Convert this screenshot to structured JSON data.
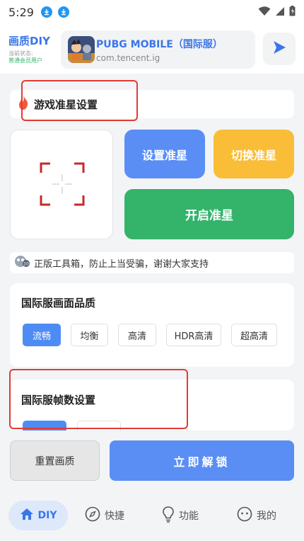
{
  "status_bar": {
    "time": "5:29"
  },
  "header": {
    "brand_title": "画质DIY",
    "brand_sub": "当前状态:",
    "brand_status": "普通会员用户",
    "game_name": "PUBG MOBILE（国际服）",
    "game_package": "com.tencent.ig"
  },
  "crosshair": {
    "section_title": "游戏准星设置",
    "set_label": "设置准星",
    "switch_label": "切换准星",
    "enable_label": "开启准星"
  },
  "notice": {
    "text": "正版工具箱，防止上当受骗，谢谢大家支持"
  },
  "quality": {
    "title": "国际服画面品质",
    "options": [
      "流畅",
      "均衡",
      "高清",
      "HDR高清",
      "超高清"
    ],
    "selected": "流畅"
  },
  "fps": {
    "title": "国际服帧数设置"
  },
  "actions": {
    "reset_label": "重置画质",
    "unlock_label": "立即解锁"
  },
  "nav": {
    "items": [
      {
        "label": "DIY",
        "icon": "home-icon"
      },
      {
        "label": "快捷",
        "icon": "compass-icon"
      },
      {
        "label": "功能",
        "icon": "bulb-icon"
      },
      {
        "label": "我的",
        "icon": "face-icon"
      }
    ]
  },
  "colors": {
    "accent": "#5a8ef5",
    "orange": "#f9bd38",
    "green": "#34b36b",
    "red": "#e53935"
  }
}
